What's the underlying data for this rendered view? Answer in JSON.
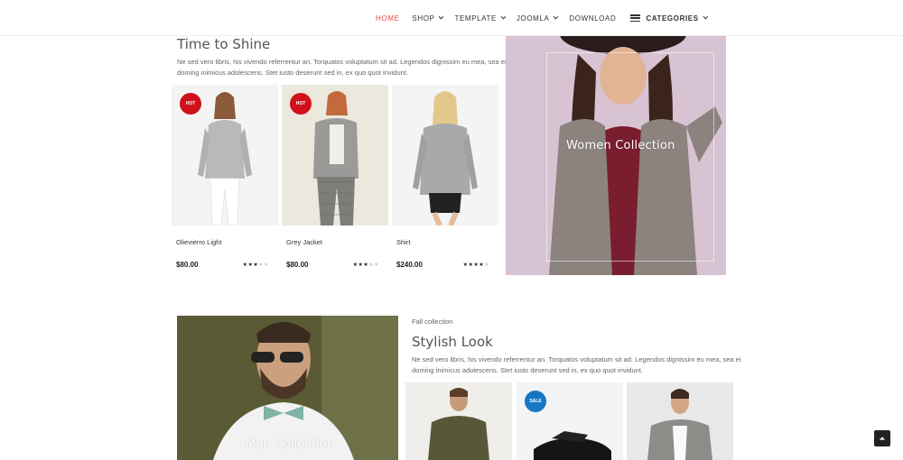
{
  "nav": {
    "items": [
      {
        "label": "HOME",
        "active": true,
        "has_caret": false
      },
      {
        "label": "SHOP",
        "active": false,
        "has_caret": true
      },
      {
        "label": "TEMPLATE",
        "active": false,
        "has_caret": true
      },
      {
        "label": "JOOMLA",
        "active": false,
        "has_caret": true
      },
      {
        "label": "DOWNLOAD",
        "active": false,
        "has_caret": false
      }
    ],
    "categories_label": "CATEGORIES",
    "accent_color": "#e84c3d"
  },
  "section1": {
    "title": "Time to Shine",
    "description_line1": "Ne sed vero libris, his vivendo referrentur an. Torquatos voluptatum sit ad. Legendos dignissim eu mea, sea ei",
    "description_line2": "doming inimicus adolescens. Stet iusto deserunt sed in, ex quo quot invidunt.",
    "products": [
      {
        "name": "Olievierro Light",
        "price": "$80.00",
        "rating": 3,
        "max_rating": 5,
        "badge": "HOT"
      },
      {
        "name": "Grey Jacket",
        "price": "$80.00",
        "rating": 3,
        "max_rating": 5,
        "badge": "HOT"
      },
      {
        "name": "Shirt",
        "price": "$240.00",
        "rating": 4,
        "max_rating": 5,
        "badge": ""
      }
    ],
    "banner_label": "Women Collection"
  },
  "section2": {
    "kicker": "Fall collection",
    "title": "Stylish Look",
    "description_line1": "Ne sed vero libris, his vivendo referrentur an. Torquatos voluptatum sit ad. Legendos dignissim eu mea, sea ei",
    "description_line2": "doming inimicus adolescens. Stet iusto deserunt sed in, ex quo quot invidunt.",
    "banner_label": "Man Collection",
    "products": [
      {
        "badge": ""
      },
      {
        "badge": "SALE"
      },
      {
        "badge": ""
      }
    ]
  },
  "icons": {
    "categories": "hamburger-icon",
    "scroll_top": "arrow-up-icon"
  },
  "colors": {
    "hot_badge": "#d0101a",
    "sale_badge": "#1877c5",
    "women_banner_bg": "#d8c3d3"
  }
}
